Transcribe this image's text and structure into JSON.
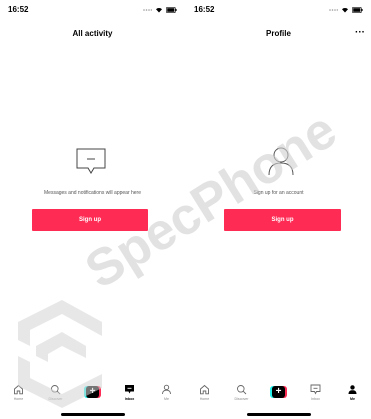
{
  "left": {
    "status": {
      "time": "16:52"
    },
    "title": "All activity",
    "empty_message": "Messages and notifications will appear here",
    "signup_label": "Sign up",
    "tabs": [
      {
        "label": "Home",
        "icon": "home-icon"
      },
      {
        "label": "Discover",
        "icon": "search-icon"
      },
      {
        "label": "",
        "icon": "create-plus-icon"
      },
      {
        "label": "Inbox",
        "icon": "inbox-icon",
        "active": true
      },
      {
        "label": "Me",
        "icon": "person-icon"
      }
    ]
  },
  "right": {
    "status": {
      "time": "16:52"
    },
    "title": "Profile",
    "more_label": "···",
    "empty_message": "Sign up for an account",
    "signup_label": "Sign up",
    "tabs": [
      {
        "label": "Home",
        "icon": "home-icon"
      },
      {
        "label": "Discover",
        "icon": "search-icon"
      },
      {
        "label": "",
        "icon": "create-plus-icon"
      },
      {
        "label": "Inbox",
        "icon": "inbox-icon"
      },
      {
        "label": "Me",
        "icon": "person-icon",
        "active": true
      }
    ]
  },
  "watermark": {
    "text": "SpecPhone"
  },
  "colors": {
    "accent": "#fe2c55",
    "cyan": "#25f4ee",
    "watermark": "#d9d9d9"
  }
}
